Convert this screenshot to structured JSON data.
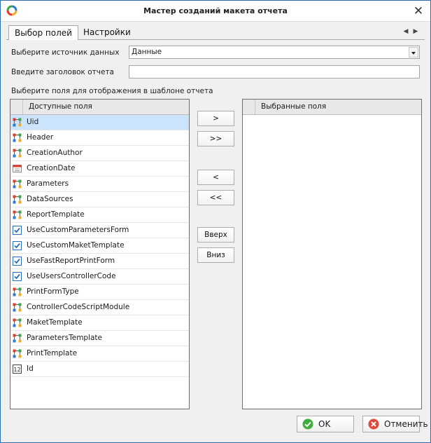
{
  "window": {
    "title": "Мастер созданий макета отчета",
    "close_glyph": "✕"
  },
  "tabs": [
    {
      "label": "Выбор полей",
      "active": true
    },
    {
      "label": "Настройки",
      "active": false
    }
  ],
  "tab_scroll": {
    "left_glyph": "◀",
    "right_glyph": "▶"
  },
  "form": {
    "source_label": "Выберите источник данных",
    "source_value": "Данные",
    "title_label": "Введите заголовок отчета",
    "title_value": "",
    "fields_label": "Выберите поля для отображения в шаблоне отчета"
  },
  "available": {
    "header": "Доступные поля",
    "items": [
      {
        "label": "Uid",
        "icon": "relation-icon",
        "selected": true
      },
      {
        "label": "Header",
        "icon": "relation-icon"
      },
      {
        "label": "CreationAuthor",
        "icon": "relation-icon"
      },
      {
        "label": "CreationDate",
        "icon": "calendar-icon"
      },
      {
        "label": "Parameters",
        "icon": "relation-icon"
      },
      {
        "label": "DataSources",
        "icon": "relation-icon"
      },
      {
        "label": "ReportTemplate",
        "icon": "relation-icon"
      },
      {
        "label": "UseCustomParametersForm",
        "icon": "checkbox-icon"
      },
      {
        "label": "UseCustomMaketTemplate",
        "icon": "checkbox-icon"
      },
      {
        "label": "UseFastReportPrintForm",
        "icon": "checkbox-icon"
      },
      {
        "label": "UseUsersControllerCode",
        "icon": "checkbox-icon"
      },
      {
        "label": "PrintFormType",
        "icon": "relation-icon"
      },
      {
        "label": "ControllerCodeScriptModule",
        "icon": "relation-icon"
      },
      {
        "label": "MaketTemplate",
        "icon": "relation-icon"
      },
      {
        "label": "ParametersTemplate",
        "icon": "relation-icon"
      },
      {
        "label": "PrintTemplate",
        "icon": "relation-icon"
      },
      {
        "label": "Id",
        "icon": "number-icon"
      }
    ]
  },
  "selected": {
    "header": "Выбранные поля"
  },
  "buttons": {
    "add": ">",
    "add_all": ">>",
    "remove": "<",
    "remove_all": "<<",
    "up": "Вверх",
    "down": "Вниз"
  },
  "footer": {
    "ok": "OK",
    "cancel": "Отменить"
  },
  "colors": {
    "selection": "#cce4fb",
    "accent_border": "#2f6db3",
    "ok_green": "#3fae3f",
    "cancel_red": "#e04a3a"
  }
}
